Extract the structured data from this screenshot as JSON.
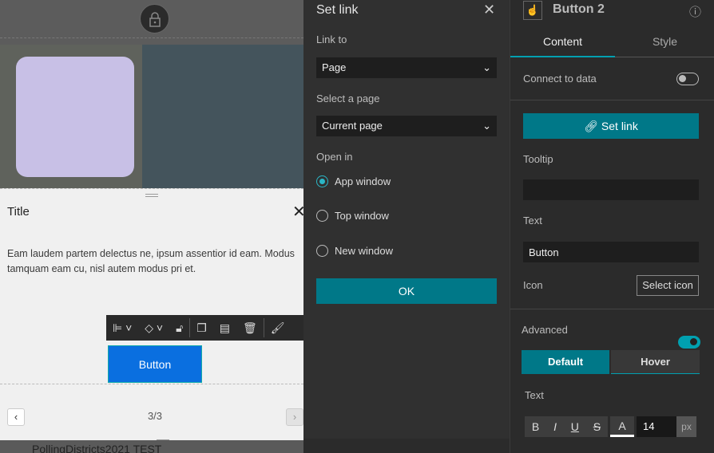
{
  "canvas": {
    "lock_icon": "lock-icon",
    "layer_label": "PollingDistricts2021 TEST",
    "colors": {
      "card": "#c8c0e6",
      "water": "#44545c",
      "button": "#0a6fe0"
    }
  },
  "widget": {
    "title": "Title",
    "body": "Eam laudem partem delectus ne, ipsum assentior id eam. Modus tamquam eam cu, nisl autem modus pri et.",
    "button_label": "Button",
    "pager": "3/3"
  },
  "toolbar": {
    "icons": [
      "align-icon",
      "layers-icon",
      "unlock-icon",
      "duplicate-icon",
      "edit-off-icon",
      "delete-icon",
      "brush-icon"
    ]
  },
  "set_link": {
    "title": "Set link",
    "link_to_label": "Link to",
    "link_to_value": "Page",
    "select_page_label": "Select a page",
    "select_page_value": "Current page",
    "open_in_label": "Open in",
    "options": [
      {
        "label": "App window",
        "selected": true
      },
      {
        "label": "Top window",
        "selected": false
      },
      {
        "label": "New window",
        "selected": false
      }
    ],
    "ok": "OK"
  },
  "settings": {
    "title": "Button 2",
    "tabs": [
      {
        "label": "Content",
        "active": true
      },
      {
        "label": "Style",
        "active": false
      }
    ],
    "connect_label": "Connect to data",
    "connect_on": false,
    "set_link_label": "Set link",
    "tooltip_label": "Tooltip",
    "tooltip_value": "",
    "text_label": "Text",
    "text_value": "Button",
    "icon_label": "Icon",
    "select_icon": "Select icon",
    "advanced_label": "Advanced",
    "advanced_on": true,
    "state_tabs": [
      {
        "label": "Default",
        "active": true
      },
      {
        "label": "Hover",
        "active": false
      }
    ],
    "text_style_label": "Text",
    "format": {
      "bold": "B",
      "italic": "I",
      "underline": "U",
      "strike": "S",
      "color": "A",
      "size": "14",
      "unit": "px"
    },
    "accent": "#007888"
  }
}
